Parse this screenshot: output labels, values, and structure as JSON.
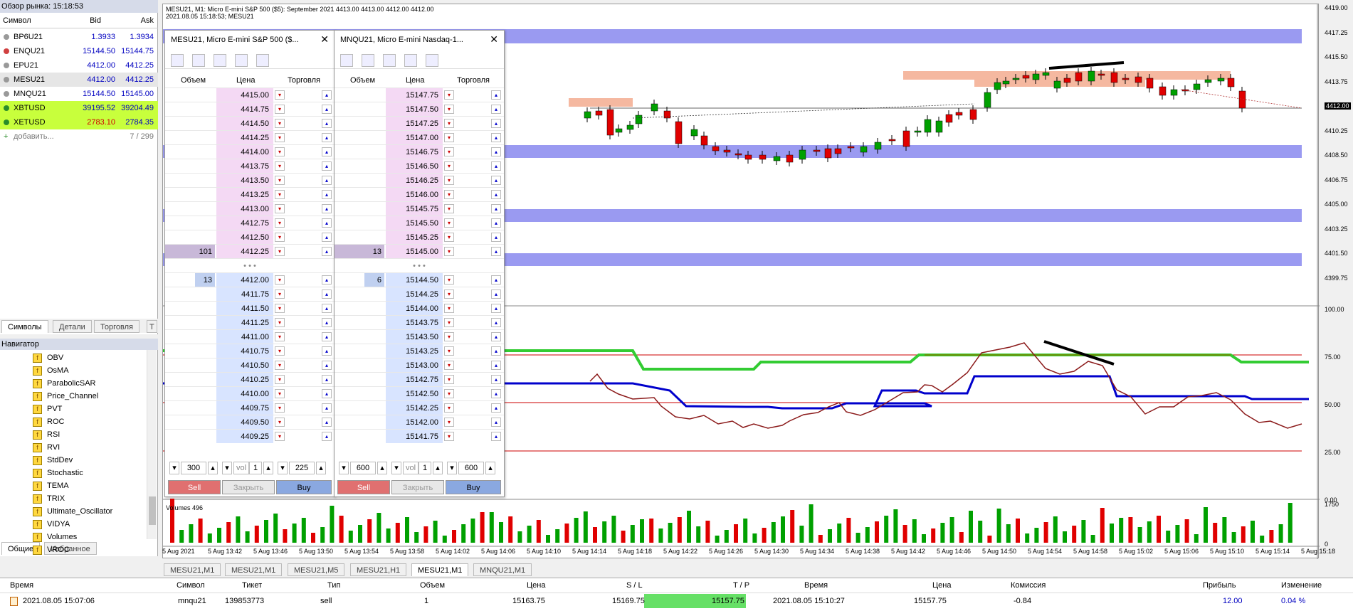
{
  "market_watch": {
    "title": "Обзор рынка: 15:18:53",
    "headers": {
      "symbol": "Символ",
      "bid": "Bid",
      "ask": "Ask"
    },
    "rows": [
      {
        "symbol": "BP6U21",
        "bid": "1.3933",
        "ask": "1.3934"
      },
      {
        "symbol": "ENQU21",
        "bid": "15144.50",
        "ask": "15144.75"
      },
      {
        "symbol": "EPU21",
        "bid": "4412.00",
        "ask": "4412.25"
      },
      {
        "symbol": "MESU21",
        "bid": "4412.00",
        "ask": "4412.25"
      },
      {
        "symbol": "MNQU21",
        "bid": "15144.50",
        "ask": "15145.00"
      },
      {
        "symbol": "XBTUSD",
        "bid": "39195.52",
        "ask": "39204.49"
      },
      {
        "symbol": "XETUSD",
        "bid": "2783.10",
        "ask": "2784.35"
      }
    ],
    "add_label": "добавить...",
    "count": "7 / 299",
    "tabs": [
      "Символы",
      "Детали",
      "Торговля",
      "Т"
    ]
  },
  "navigator": {
    "title": "Навигатор",
    "items": [
      "OBV",
      "OsMA",
      "ParabolicSAR",
      "Price_Channel",
      "PVT",
      "ROC",
      "RSI",
      "RVI",
      "StdDev",
      "Stochastic",
      "TEMA",
      "TRIX",
      "Ultimate_Oscillator",
      "VIDYA",
      "Volumes",
      "VROC"
    ],
    "tabs": [
      "Общие",
      "Избранное"
    ]
  },
  "chart": {
    "header_line1": "MESU21, M1:  Micro E-mini S&P 500 ($5): September 2021   4413.00 4413.00 4412.00 4412.00",
    "header_line2": "2021.08.05 15:18:53; MESU21",
    "price_labels": [
      "4419.00",
      "4417.25",
      "4415.50",
      "4413.75",
      "4412.00",
      "4410.25",
      "4408.50",
      "4406.75",
      "4405.00",
      "4403.25",
      "4401.50",
      "4399.75"
    ],
    "osc_labels": [
      "100.00",
      "75.00",
      "50.00",
      "25.00",
      "0.00"
    ],
    "volume_title": "Volumes 496",
    "volume_labels": [
      "1750",
      "0"
    ],
    "time_labels": [
      "5 Aug 2021",
      "5 Aug 13:42",
      "5 Aug 13:46",
      "5 Aug 13:50",
      "5 Aug 13:54",
      "5 Aug 13:58",
      "5 Aug 14:02",
      "5 Aug 14:06",
      "5 Aug 14:10",
      "5 Aug 14:14",
      "5 Aug 14:18",
      "5 Aug 14:22",
      "5 Aug 14:26",
      "5 Aug 14:30",
      "5 Aug 14:34",
      "5 Aug 14:38",
      "5 Aug 14:42",
      "5 Aug 14:46",
      "5 Aug 14:50",
      "5 Aug 14:54",
      "5 Aug 14:58",
      "5 Aug 15:02",
      "5 Aug 15:06",
      "5 Aug 15:10",
      "5 Aug 15:14",
      "5 Aug 15:18"
    ],
    "tabs": [
      "MESU21,M1",
      "MESU21,M1",
      "MESU21,M5",
      "MESU21,H1",
      "MESU21,M1",
      "MNQU21,M1"
    ]
  },
  "dom1": {
    "title": "MESU21, Micro E-mini S&P 500 ($...",
    "headers": {
      "vol": "Объем",
      "price": "Цена",
      "trade": "Торговля"
    },
    "asks": [
      {
        "price": "4415.00",
        "vol": ""
      },
      {
        "price": "4414.75",
        "vol": ""
      },
      {
        "price": "4414.50",
        "vol": ""
      },
      {
        "price": "4414.25",
        "vol": ""
      },
      {
        "price": "4414.00",
        "vol": ""
      },
      {
        "price": "4413.75",
        "vol": ""
      },
      {
        "price": "4413.50",
        "vol": ""
      },
      {
        "price": "4413.25",
        "vol": ""
      },
      {
        "price": "4413.00",
        "vol": ""
      },
      {
        "price": "4412.75",
        "vol": ""
      },
      {
        "price": "4412.50",
        "vol": ""
      },
      {
        "price": "4412.25",
        "vol": "101"
      }
    ],
    "bids": [
      {
        "price": "4412.00",
        "vol": "13"
      },
      {
        "price": "4411.75",
        "vol": ""
      },
      {
        "price": "4411.50",
        "vol": ""
      },
      {
        "price": "4411.25",
        "vol": ""
      },
      {
        "price": "4411.00",
        "vol": ""
      },
      {
        "price": "4410.75",
        "vol": ""
      },
      {
        "price": "4410.50",
        "vol": ""
      },
      {
        "price": "4410.25",
        "vol": ""
      },
      {
        "price": "4410.00",
        "vol": ""
      },
      {
        "price": "4409.75",
        "vol": ""
      },
      {
        "price": "4409.50",
        "vol": ""
      },
      {
        "price": "4409.25",
        "vol": ""
      }
    ],
    "sl": "300",
    "vol_label": "vol",
    "vol": "1",
    "tp": "225",
    "sell": "Sell",
    "close": "Закрыть",
    "buy": "Buy"
  },
  "dom2": {
    "title": "MNQU21, Micro E-mini Nasdaq-1...",
    "headers": {
      "vol": "Объем",
      "price": "Цена",
      "trade": "Торговля"
    },
    "asks": [
      {
        "price": "15147.75",
        "vol": ""
      },
      {
        "price": "15147.50",
        "vol": ""
      },
      {
        "price": "15147.25",
        "vol": ""
      },
      {
        "price": "15147.00",
        "vol": ""
      },
      {
        "price": "15146.75",
        "vol": ""
      },
      {
        "price": "15146.50",
        "vol": ""
      },
      {
        "price": "15146.25",
        "vol": ""
      },
      {
        "price": "15146.00",
        "vol": ""
      },
      {
        "price": "15145.75",
        "vol": ""
      },
      {
        "price": "15145.50",
        "vol": ""
      },
      {
        "price": "15145.25",
        "vol": ""
      },
      {
        "price": "15145.00",
        "vol": "13"
      }
    ],
    "bids": [
      {
        "price": "15144.50",
        "vol": "6"
      },
      {
        "price": "15144.25",
        "vol": ""
      },
      {
        "price": "15144.00",
        "vol": ""
      },
      {
        "price": "15143.75",
        "vol": ""
      },
      {
        "price": "15143.50",
        "vol": ""
      },
      {
        "price": "15143.25",
        "vol": ""
      },
      {
        "price": "15143.00",
        "vol": ""
      },
      {
        "price": "15142.75",
        "vol": ""
      },
      {
        "price": "15142.50",
        "vol": ""
      },
      {
        "price": "15142.25",
        "vol": ""
      },
      {
        "price": "15142.00",
        "vol": ""
      },
      {
        "price": "15141.75",
        "vol": ""
      }
    ],
    "sl": "600",
    "vol_label": "vol",
    "vol": "1",
    "tp": "600",
    "sell": "Sell",
    "close": "Закрыть",
    "buy": "Buy"
  },
  "trade": {
    "headers": [
      "Время",
      "Символ",
      "Тикет",
      "Тип",
      "Объем",
      "Цена",
      "S / L",
      "T / P",
      "Время",
      "Цена",
      "Комиссия",
      "Прибыль",
      "Изменение"
    ],
    "row": [
      "2021.08.05 15:07:06",
      "mnqu21",
      "139853773",
      "sell",
      "1",
      "15163.75",
      "15169.75",
      "15157.75",
      "2021.08.05 15:10:27",
      "15157.75",
      "-0.84",
      "12.00",
      "0.04 %"
    ]
  },
  "colors": {
    "bull": "#00a000",
    "bear": "#e00000",
    "zone_blue": "#8888ee",
    "zone_salmon": "#f5b8a0",
    "osc_green": "#33cc33",
    "osc_blue": "#0000cc",
    "osc_brown": "#8b1a1a",
    "hl_green": "#c8ff3c"
  }
}
